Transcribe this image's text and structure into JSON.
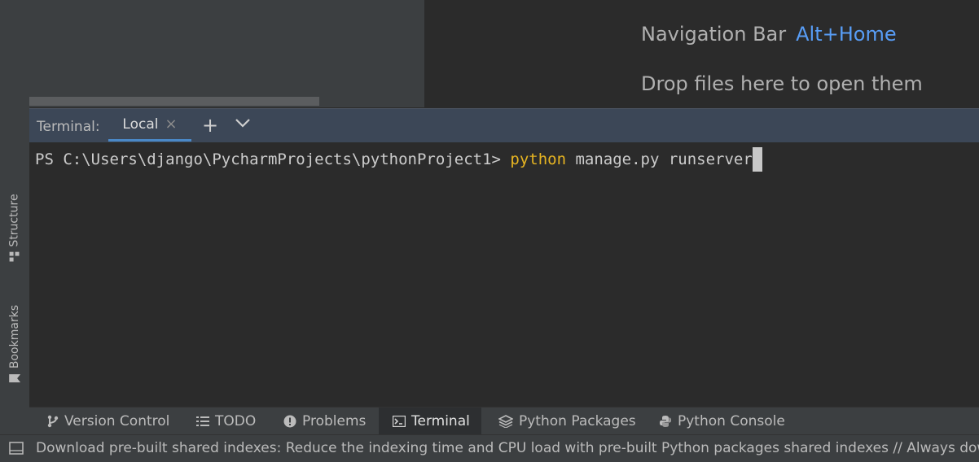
{
  "editor_hints": {
    "navigation_label": "Navigation Bar",
    "navigation_key": "Alt+Home",
    "drop_files": "Drop files here to open them"
  },
  "terminal": {
    "label": "Terminal:",
    "tab_label": "Local",
    "prompt": "PS C:\\Users\\django\\PycharmProjects\\pythonProject1> ",
    "command_keyword": "python",
    "command_rest": " manage.py runserver"
  },
  "side_tabs": {
    "structure": "Structure",
    "bookmarks": "Bookmarks"
  },
  "tool_windows": [
    {
      "label": "Version Control",
      "icon": "branch-icon"
    },
    {
      "label": "TODO",
      "icon": "list-icon"
    },
    {
      "label": "Problems",
      "icon": "exclamation-icon"
    },
    {
      "label": "Terminal",
      "icon": "terminal-icon",
      "active": true
    },
    {
      "label": "Python Packages",
      "icon": "layers-icon"
    },
    {
      "label": "Python Console",
      "icon": "python-icon"
    }
  ],
  "status_bar": {
    "message": "Download pre-built shared indexes: Reduce the indexing time and CPU load with pre-built Python packages shared indexes // Always dow"
  },
  "colors": {
    "background": "#2b2b2b",
    "panel": "#3c3f41",
    "terminal_header": "#3c4757",
    "accent": "#4a88c7",
    "link": "#589df6",
    "keyword": "#e6b422"
  }
}
